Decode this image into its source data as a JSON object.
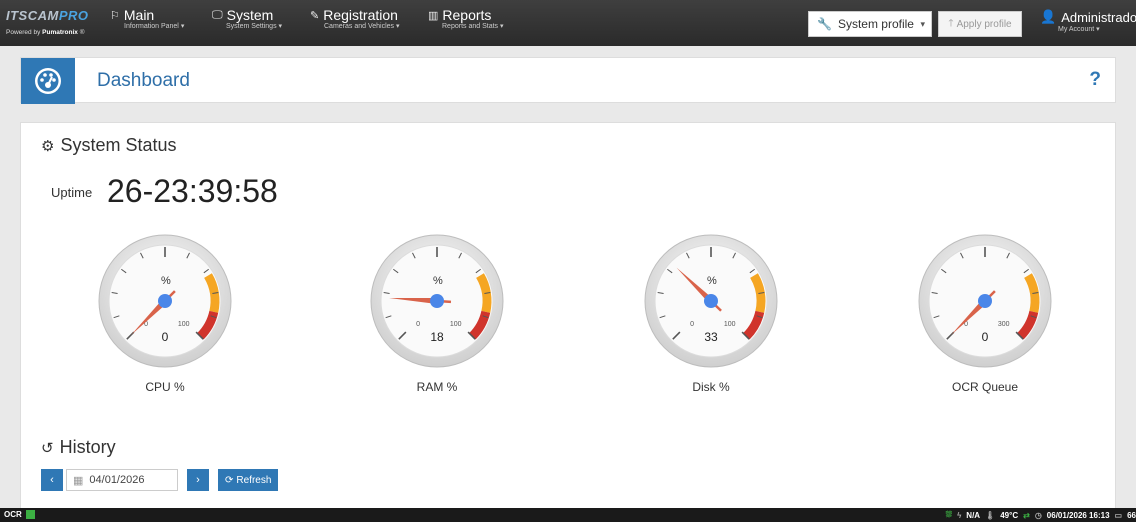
{
  "topbar": {
    "brand": "ITSCAM",
    "brand_accent": "PRO",
    "powered_prefix": "Powered by ",
    "powered_name": "Pumatronix",
    "powered_suffix": " ®",
    "nav": [
      {
        "title": "Main",
        "subtitle": "Information Panel",
        "icon": "flag-icon"
      },
      {
        "title": "System",
        "subtitle": "System Settings",
        "icon": "monitor-icon"
      },
      {
        "title": "Registration",
        "subtitle": "Cameras and Vehicles",
        "icon": "edit-icon"
      },
      {
        "title": "Reports",
        "subtitle": "Reports and Stats",
        "icon": "bar-chart-icon"
      }
    ],
    "profile_select": "System profile",
    "apply_profile": "Apply profile",
    "account_name": "Administrador",
    "account_sub": "My Account"
  },
  "header": {
    "title": "Dashboard",
    "help": "?"
  },
  "status": {
    "title": "System Status",
    "uptime_label": "Uptime",
    "uptime_value": "26-23:39:58"
  },
  "gauges": [
    {
      "label": "CPU %",
      "value": 0,
      "max": 100,
      "unit": "%",
      "min_label": "0",
      "max_label": "100",
      "display": "0"
    },
    {
      "label": "RAM %",
      "value": 18,
      "max": 100,
      "unit": "%",
      "min_label": "0",
      "max_label": "100",
      "display": "18"
    },
    {
      "label": "Disk %",
      "value": 33,
      "max": 100,
      "unit": "%",
      "min_label": "0",
      "max_label": "100",
      "display": "33"
    },
    {
      "label": "OCR Queue",
      "value": 0,
      "max": 300,
      "unit": "",
      "min_label": "0",
      "max_label": "300",
      "display": "0"
    }
  ],
  "history": {
    "title": "History",
    "date": "04/01/2026",
    "prev": "‹",
    "next": "›",
    "refresh": "Refresh"
  },
  "statusbar": {
    "ocr": "OCR",
    "na": "N/A",
    "temp": "49°C",
    "datetime": "06/01/2026 16:13",
    "disk": "66"
  },
  "colors": {
    "accent": "#2f78b5",
    "needle": "#d9634a",
    "hub": "#4a86e8",
    "band_orange": "#f5a623",
    "band_red": "#d0342c",
    "ok_green": "#3cb043"
  }
}
